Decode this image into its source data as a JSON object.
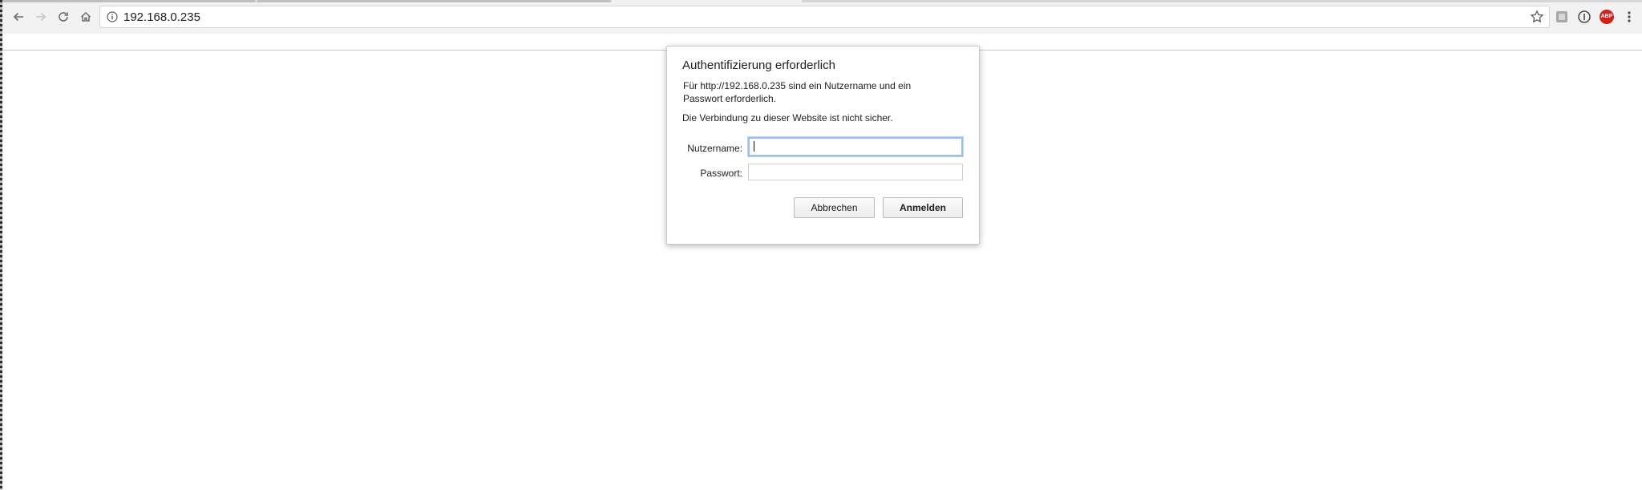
{
  "browser": {
    "url": "192.168.0.235",
    "icons": {
      "back": "arrow-left-icon",
      "forward": "arrow-right-icon",
      "reload": "reload-icon",
      "home": "home-icon",
      "site_info": "info-icon",
      "bookmark": "star-icon",
      "extension_1": "extension-icon",
      "extension_2": "info-circle-icon",
      "adblock": "abp-icon",
      "menu": "kebab-menu-icon"
    },
    "adblock_badge": "ABP"
  },
  "auth_dialog": {
    "title": "Authentifizierung erforderlich",
    "message": "Für http://192.168.0.235 sind ein Nutzername und ein Passwort erforderlich.",
    "warning": "Die Verbindung zu dieser Website ist nicht sicher.",
    "username_label": "Nutzername:",
    "username_value": "",
    "password_label": "Passwort:",
    "password_value": "",
    "cancel_label": "Abbrechen",
    "login_label": "Anmelden"
  },
  "colors": {
    "focus_ring": "#9cc1ec",
    "abp_red": "#d0211c",
    "toolbar_bg": "#f2f2f2"
  }
}
